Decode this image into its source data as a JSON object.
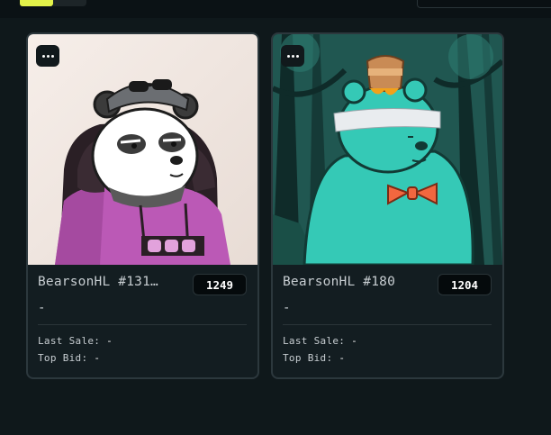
{
  "toolbar": {
    "accent_color": "#e3f34a"
  },
  "cards": [
    {
      "name": "BearsonHL #131…",
      "price": "1249",
      "subtitle": "-",
      "last_sale_label": "Last Sale:",
      "last_sale_value": "-",
      "top_bid_label": "Top Bid:",
      "top_bid_value": "-",
      "image_icon": "panda-bear-hoodie-icon"
    },
    {
      "name": "BearsonHL #180",
      "price": "1204",
      "subtitle": "-",
      "last_sale_label": "Last Sale:",
      "last_sale_value": "-",
      "top_bid_label": "Top Bid:",
      "top_bid_value": "-",
      "image_icon": "teal-bear-bowtie-icon"
    }
  ]
}
